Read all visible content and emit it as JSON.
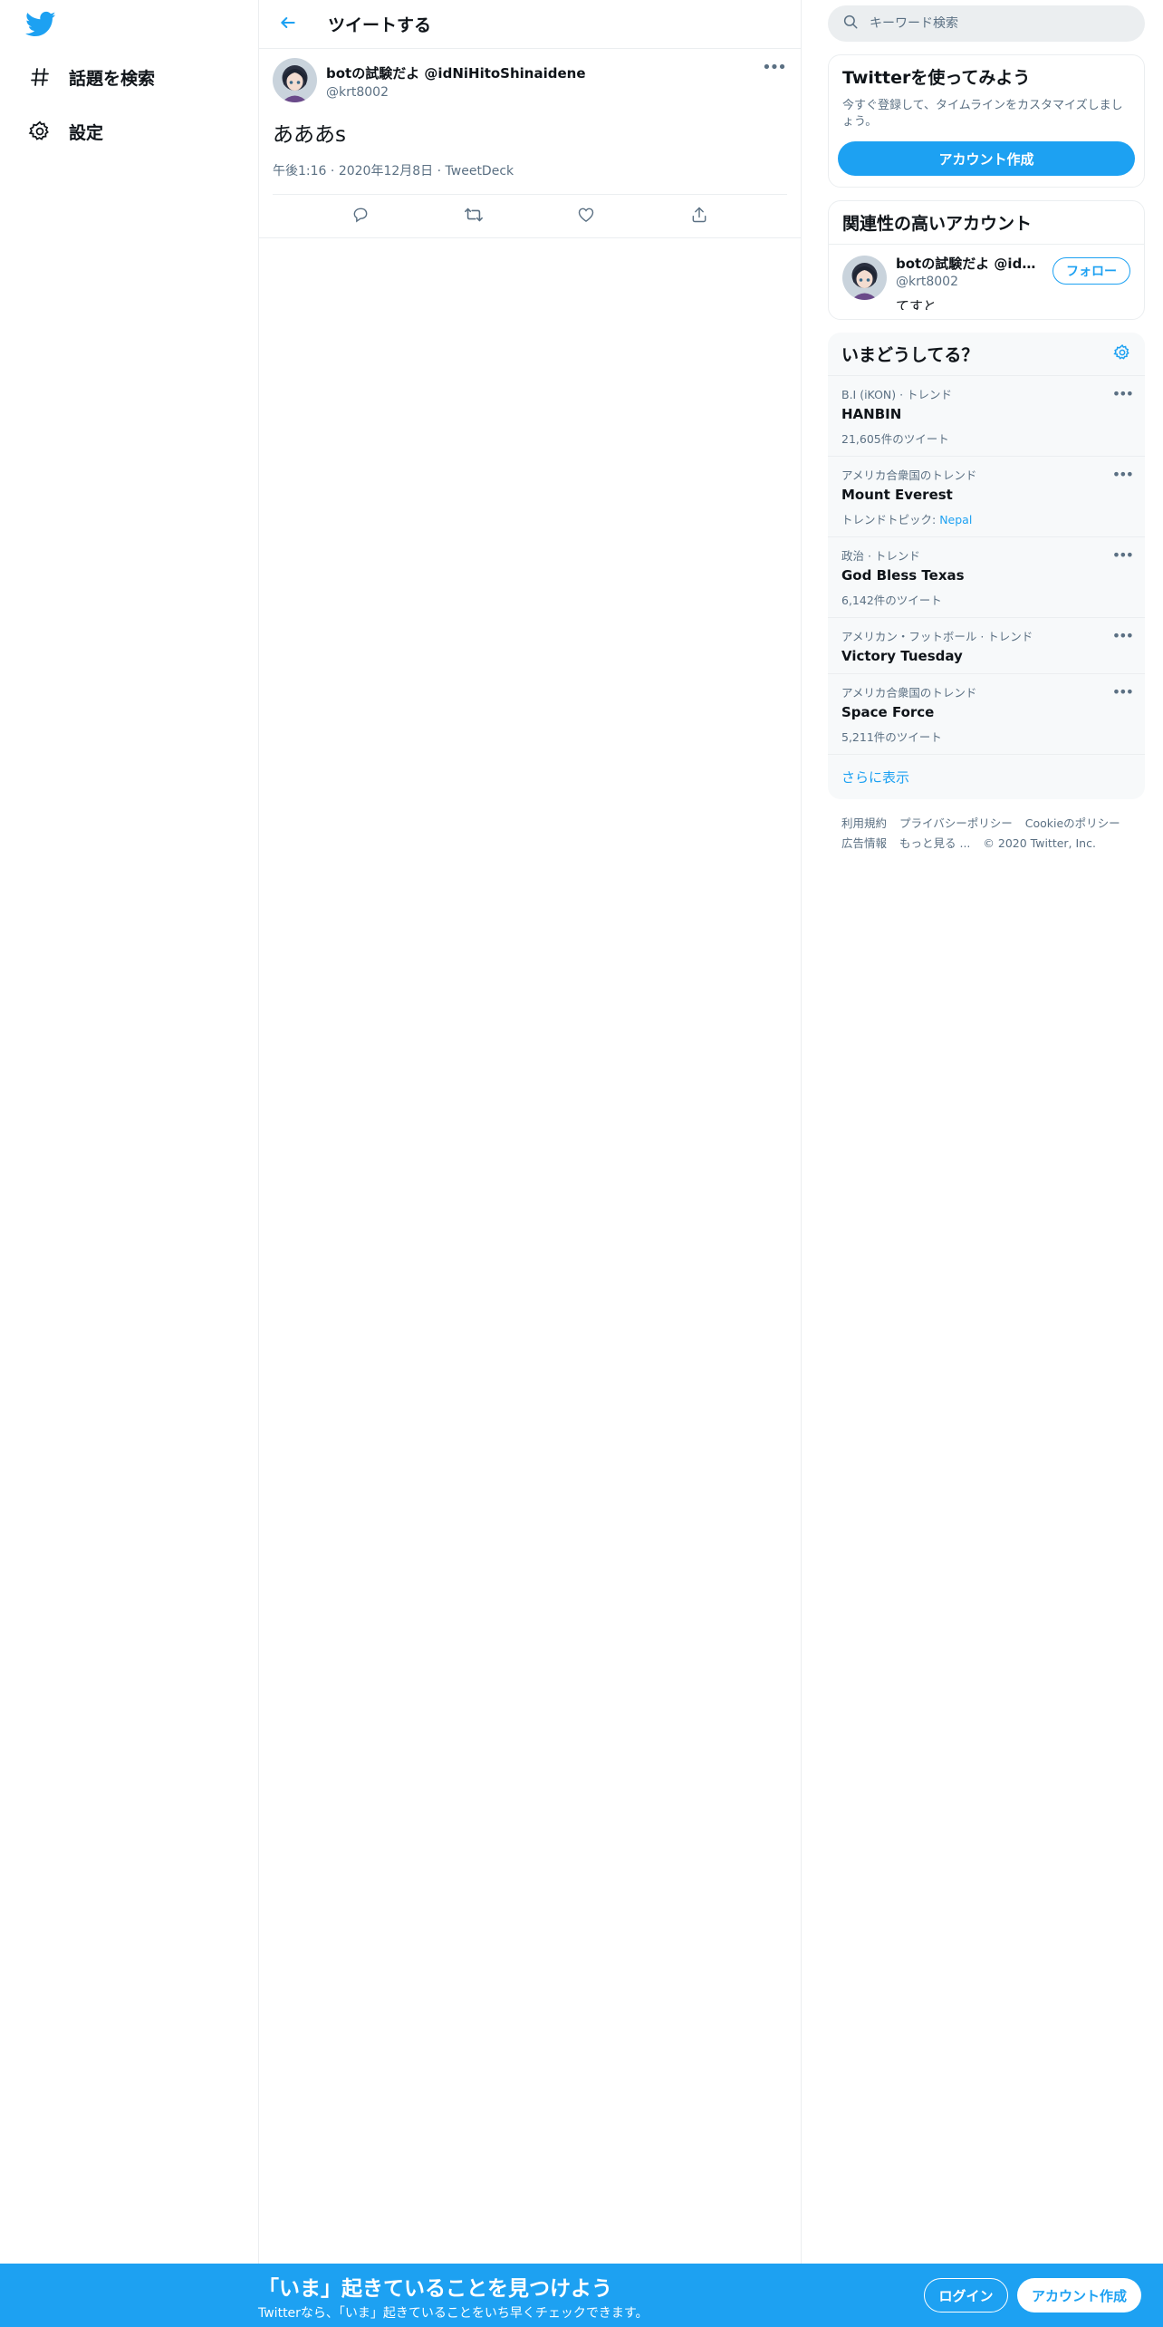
{
  "colors": {
    "brand": "#1da1f2",
    "text": "#0f1419",
    "muted": "#5b7083",
    "border": "#ebeef0"
  },
  "nav": {
    "logo_icon": "twitter-bird-icon",
    "items": [
      {
        "label": "話題を検索",
        "icon": "hashtag-icon"
      },
      {
        "label": "設定",
        "icon": "gear-icon"
      }
    ]
  },
  "header": {
    "title": "ツイートする",
    "back_icon": "back-arrow-icon"
  },
  "tweet": {
    "author_name": "botの試験だよ @idNiHitoShinaidene",
    "author_handle": "@krt8002",
    "text": "あああs",
    "time": "午後1:16",
    "date": "2020年12月8日",
    "source": "TweetDeck",
    "actions": [
      "reply-icon",
      "retweet-icon",
      "like-icon",
      "share-icon"
    ]
  },
  "search": {
    "placeholder": "キーワード検索"
  },
  "signup_card": {
    "title": "Twitterを使ってみよう",
    "description": "今すぐ登録して、タイムラインをカスタマイズしましょう。",
    "button": "アカウント作成"
  },
  "related": {
    "title": "関連性の高いアカウント",
    "user": {
      "name": "botの試験だよ @idNi...",
      "handle": "@krt8002",
      "bio": "てすと",
      "follow_label": "フォロー"
    }
  },
  "trends": {
    "title": "いまどうしてる？",
    "items": [
      {
        "context": "B.I (iKON) · トレンド",
        "name": "HANBIN",
        "count": "21,605件のツイート"
      },
      {
        "context": "アメリカ合衆国のトレンド",
        "name": "Mount Everest",
        "count_prefix": "トレンドトピック:",
        "topic": "Nepal"
      },
      {
        "context": "政治 · トレンド",
        "name": "God Bless Texas",
        "count": "6,142件のツイート"
      },
      {
        "context": "アメリカン・フットボール · トレンド",
        "name": "Victory Tuesday"
      },
      {
        "context": "アメリカ合衆国のトレンド",
        "name": "Space Force",
        "count": "5,211件のツイート"
      }
    ],
    "show_more": "さらに表示"
  },
  "footer": {
    "links": [
      "利用規約",
      "プライバシーポリシー",
      "Cookieのポリシー",
      "広告情報",
      "もっと見る ..."
    ],
    "copyright": "© 2020 Twitter, Inc."
  },
  "banner": {
    "title": "「いま」起きていることを見つけよう",
    "subtitle": "Twitterなら、「いま」起きていることをいち早くチェックできます。",
    "login": "ログイン",
    "signup": "アカウント作成"
  }
}
